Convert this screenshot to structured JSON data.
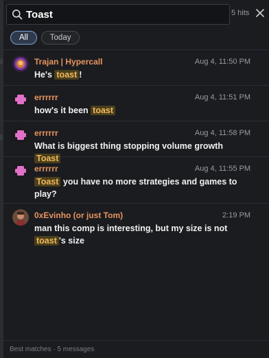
{
  "search": {
    "query": "Toast",
    "hits_label": "5 hits"
  },
  "filters": [
    {
      "label": "All",
      "active": true
    },
    {
      "label": "Today",
      "active": false
    }
  ],
  "results": [
    {
      "author": "Trajan | Hypercall",
      "time": "Aug 4, 11:50 PM",
      "segments": [
        {
          "t": "He's "
        },
        {
          "t": "toast",
          "hl": true
        },
        {
          "t": "!"
        }
      ]
    },
    {
      "author": "errrrrr",
      "time": "Aug 4, 11:51 PM",
      "segments": [
        {
          "t": "how's it been "
        },
        {
          "t": "toast",
          "hl": true
        }
      ]
    },
    {
      "author": "errrrrr",
      "time": "Aug 4, 11:58 PM",
      "segments": [
        {
          "t": "What is biggest thing stopping volume growth "
        },
        {
          "t": "Toast",
          "hl": true
        }
      ]
    },
    {
      "author": "errrrrr",
      "time": "Aug 4, 11:55 PM",
      "segments": [
        {
          "t": "Toast",
          "hl": true
        },
        {
          "t": " you have no more strategies and games to play?"
        }
      ]
    },
    {
      "author": "0xEvinho (or just Tom)",
      "time": "2:19 PM",
      "segments": [
        {
          "t": "man this comp is interesting, but my size is not "
        },
        {
          "t": "toast",
          "hl": true
        },
        {
          "t": "'s size"
        }
      ]
    }
  ],
  "footer": {
    "text": "Best matches · 5 messages"
  },
  "colors": {
    "accent_author": "#e8955e",
    "highlight_bg": "#4a3f1c",
    "highlight_text": "#f0b85a",
    "avatar_pink": "#e070c8"
  }
}
